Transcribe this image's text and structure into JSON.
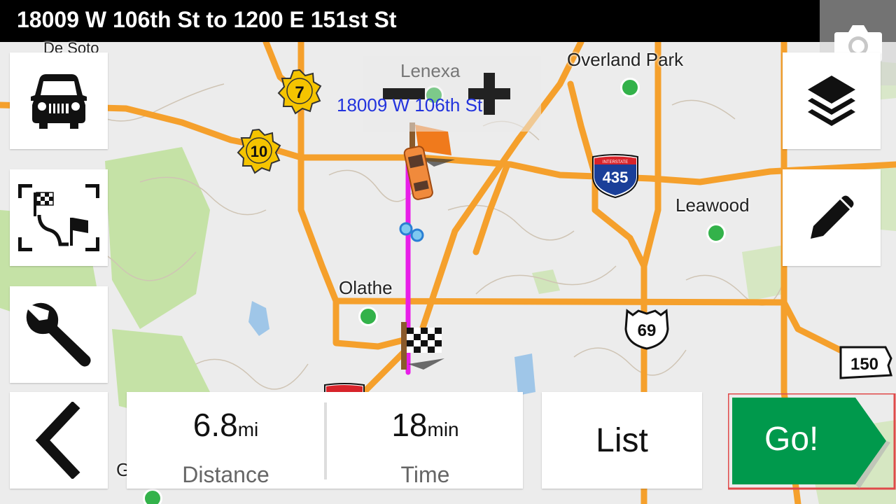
{
  "route": {
    "title": "18009 W 106th St to 1200 E 151st St",
    "start_label": "18009 W 106th St"
  },
  "map": {
    "places": {
      "overland_park": "Overland Park",
      "lenexa": "Lenexa",
      "leawood": "Leawood",
      "olathe": "Olathe",
      "de_soto": "De Soto",
      "partial_g": "G"
    },
    "shields": {
      "hwy7": "7",
      "hwy10": "10",
      "i435": "435",
      "i435_banner": "INTERSTATE",
      "us69": "69",
      "mo150": "150"
    },
    "colors": {
      "route_line": "#e81ee8",
      "road": "#f5a02c",
      "park": "#b7dc8e",
      "water": "#9fc6e8",
      "go_button": "#00994c"
    }
  },
  "stats": {
    "distance_value": "6.8",
    "distance_unit": "mi",
    "distance_label": "Distance",
    "time_value": "18",
    "time_unit": "min",
    "time_label": "Time"
  },
  "buttons": {
    "list_label": "List",
    "go_label": "Go!"
  },
  "icons": {
    "vehicle": "car-icon",
    "route_overview": "route-overview-icon",
    "settings": "wrench-icon",
    "back": "chevron-left-icon",
    "layers": "layers-icon",
    "edit": "pencil-icon",
    "camera": "camera-icon",
    "zoom_in": "plus-icon",
    "zoom_out": "minus-icon"
  }
}
